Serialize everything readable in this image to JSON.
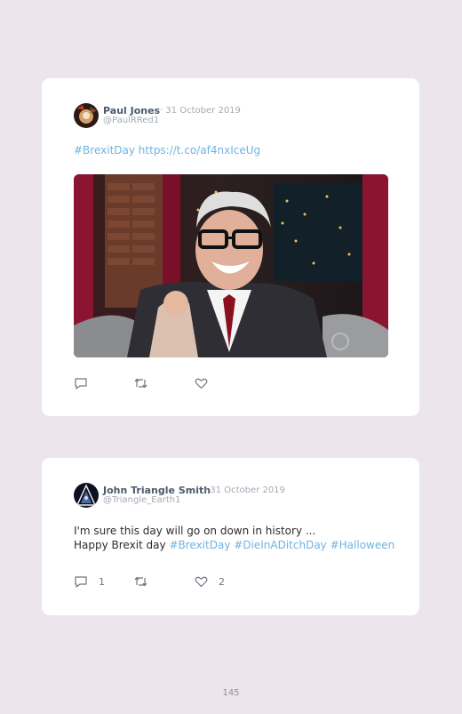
{
  "tweets": [
    {
      "name": "Paul Jones",
      "date": "· 31 October 2019",
      "handle": "@PaulRRed1",
      "text_line1_tags": [
        {
          "text": "#BrexitDay",
          "tag": true
        },
        {
          "text": " ",
          "tag": false
        },
        {
          "text": "https://t.co/af4nxIceUg",
          "tag": true
        }
      ],
      "replies": "",
      "retweets": "",
      "likes": ""
    },
    {
      "name": "John Triangle Smith",
      "date": "· 31 October 2019",
      "handle": "@Triangle_Earth1",
      "line1": "I'm sure this day will go on down in history ...",
      "line2_plain": "Happy Brexit day ",
      "line2_tags": "#BrexitDay #DieInADitchDay #Halloween",
      "replies": "1",
      "retweets": "",
      "likes": "2"
    }
  ],
  "icons": [
    "reply-icon",
    "retweet-icon",
    "like-icon"
  ],
  "colors": {
    "background": "#ece6ec",
    "card": "#ffffff",
    "link": "#6fb4e1",
    "name": "#4d5a6b",
    "meta": "#a3aab4"
  },
  "page_number": "145"
}
